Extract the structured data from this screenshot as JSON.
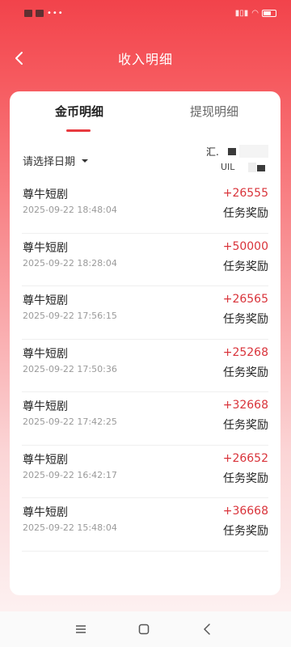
{
  "header": {
    "title": "收入明细"
  },
  "tabs": [
    {
      "label": "金币明细",
      "active": true
    },
    {
      "label": "提现明细",
      "active": false
    }
  ],
  "filter": {
    "date_label": "请选择日期",
    "summary_label": "汇.",
    "summary_sub": "UIL"
  },
  "records": [
    {
      "title": "尊牛短剧",
      "time": "2025-09-22 18:48:04",
      "amount": "+26555",
      "reason": "任务奖励"
    },
    {
      "title": "尊牛短剧",
      "time": "2025-09-22 18:28:04",
      "amount": "+50000",
      "reason": "任务奖励"
    },
    {
      "title": "尊牛短剧",
      "time": "2025-09-22 17:56:15",
      "amount": "+26565",
      "reason": "任务奖励"
    },
    {
      "title": "尊牛短剧",
      "time": "2025-09-22 17:50:36",
      "amount": "+25268",
      "reason": "任务奖励"
    },
    {
      "title": "尊牛短剧",
      "time": "2025-09-22 17:42:25",
      "amount": "+32668",
      "reason": "任务奖励"
    },
    {
      "title": "尊牛短剧",
      "time": "2025-09-22 16:42:17",
      "amount": "+26652",
      "reason": "任务奖励"
    },
    {
      "title": "尊牛短剧",
      "time": "2025-09-22 15:48:04",
      "amount": "+36668",
      "reason": "任务奖励"
    }
  ],
  "colors": {
    "accent": "#e83a3f",
    "amount": "#d9333a",
    "header_bg": "#f2434b"
  },
  "icons": [
    "back-arrow-icon",
    "caret-down-icon",
    "menu-icon",
    "home-icon",
    "system-back-icon"
  ]
}
